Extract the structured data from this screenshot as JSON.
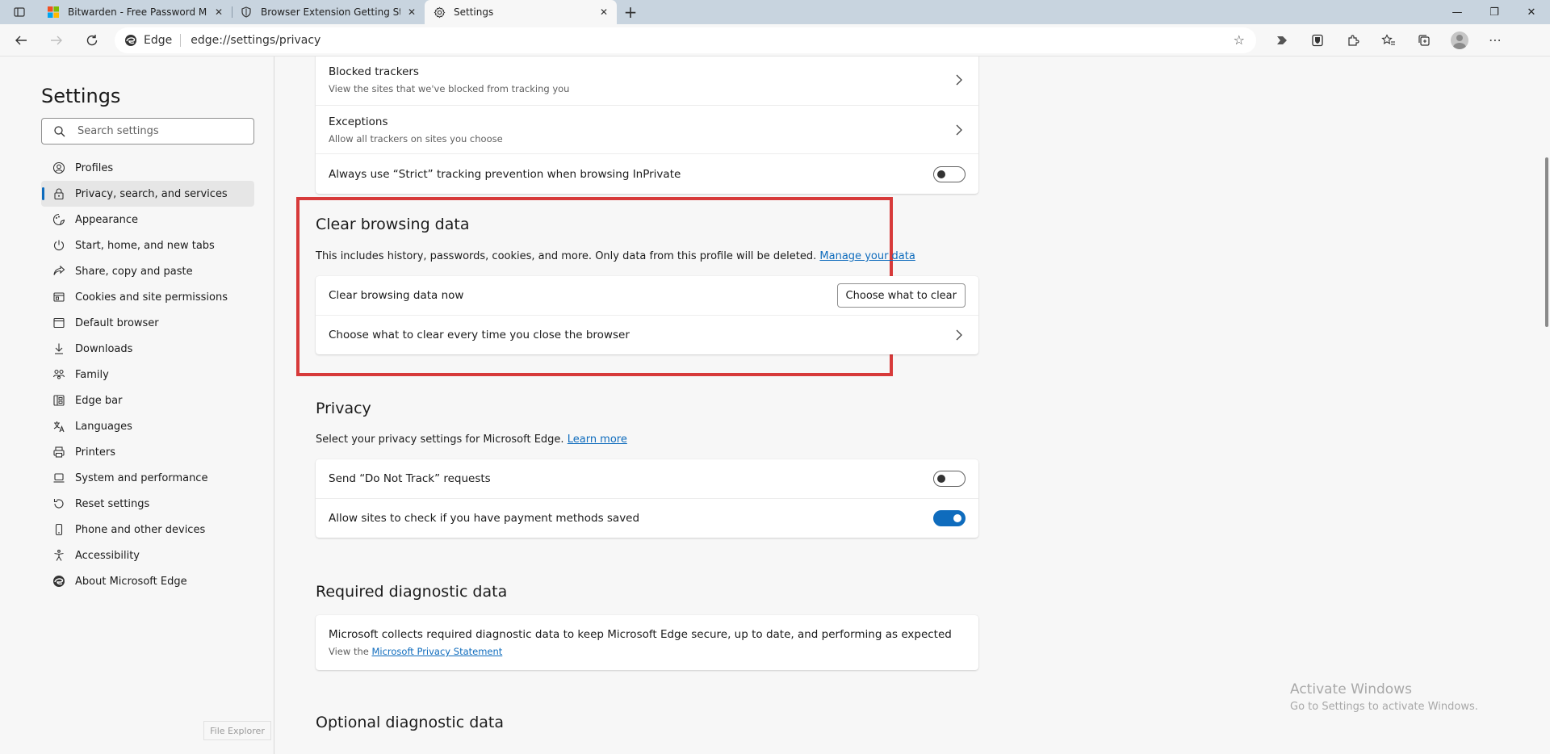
{
  "tabs": [
    {
      "title": "Bitwarden - Free Password Mana",
      "icon": "microsoft-logo-icon",
      "active": false
    },
    {
      "title": "Browser Extension Getting Starte",
      "icon": "shield-icon",
      "active": false
    },
    {
      "title": "Settings",
      "icon": "gear-icon",
      "active": true
    }
  ],
  "address_bar": {
    "site_label": "Edge",
    "url": "edge://settings/privacy"
  },
  "sidebar": {
    "title": "Settings",
    "search_placeholder": "Search settings",
    "items": [
      {
        "label": "Profiles",
        "icon": "profile-icon"
      },
      {
        "label": "Privacy, search, and services",
        "icon": "lock-icon"
      },
      {
        "label": "Appearance",
        "icon": "appearance-icon"
      },
      {
        "label": "Start, home, and new tabs",
        "icon": "power-icon"
      },
      {
        "label": "Share, copy and paste",
        "icon": "share-icon"
      },
      {
        "label": "Cookies and site permissions",
        "icon": "cookie-icon"
      },
      {
        "label": "Default browser",
        "icon": "browser-icon"
      },
      {
        "label": "Downloads",
        "icon": "download-icon"
      },
      {
        "label": "Family",
        "icon": "family-icon"
      },
      {
        "label": "Edge bar",
        "icon": "edge-bar-icon"
      },
      {
        "label": "Languages",
        "icon": "languages-icon"
      },
      {
        "label": "Printers",
        "icon": "printer-icon"
      },
      {
        "label": "System and performance",
        "icon": "laptop-icon"
      },
      {
        "label": "Reset settings",
        "icon": "reset-icon"
      },
      {
        "label": "Phone and other devices",
        "icon": "phone-icon"
      },
      {
        "label": "Accessibility",
        "icon": "accessibility-icon"
      },
      {
        "label": "About Microsoft Edge",
        "icon": "edge-logo-icon"
      }
    ],
    "tooltip": "File Explorer"
  },
  "tracking": {
    "blocked_title": "Blocked trackers",
    "blocked_sub": "View the sites that we've blocked from tracking you",
    "exceptions_title": "Exceptions",
    "exceptions_sub": "Allow all trackers on sites you choose",
    "strict_title": "Always use “Strict” tracking prevention when browsing InPrivate",
    "strict_on": false
  },
  "clear_data": {
    "title": "Clear browsing data",
    "desc": "This includes history, passwords, cookies, and more. Only data from this profile will be deleted.",
    "link": "Manage your data",
    "now_title": "Clear browsing data now",
    "button": "Choose what to clear",
    "every_time_title": "Choose what to clear every time you close the browser"
  },
  "privacy": {
    "title": "Privacy",
    "desc": "Select your privacy settings for Microsoft Edge.",
    "link": "Learn more",
    "dnt_title": "Send “Do Not Track” requests",
    "dnt_on": false,
    "payment_title": "Allow sites to check if you have payment methods saved",
    "payment_on": true
  },
  "diagnostic": {
    "title": "Required diagnostic data",
    "row_title": "Microsoft collects required diagnostic data to keep Microsoft Edge secure, up to date, and performing as expected",
    "row_sub_prefix": "View the",
    "row_sub_link": "Microsoft Privacy Statement"
  },
  "optional": {
    "title": "Optional diagnostic data"
  },
  "watermark": {
    "title": "Activate Windows",
    "sub": "Go to Settings to activate Windows."
  },
  "colors": {
    "accent": "#0f6cbd",
    "highlight": "#d73a3a"
  }
}
